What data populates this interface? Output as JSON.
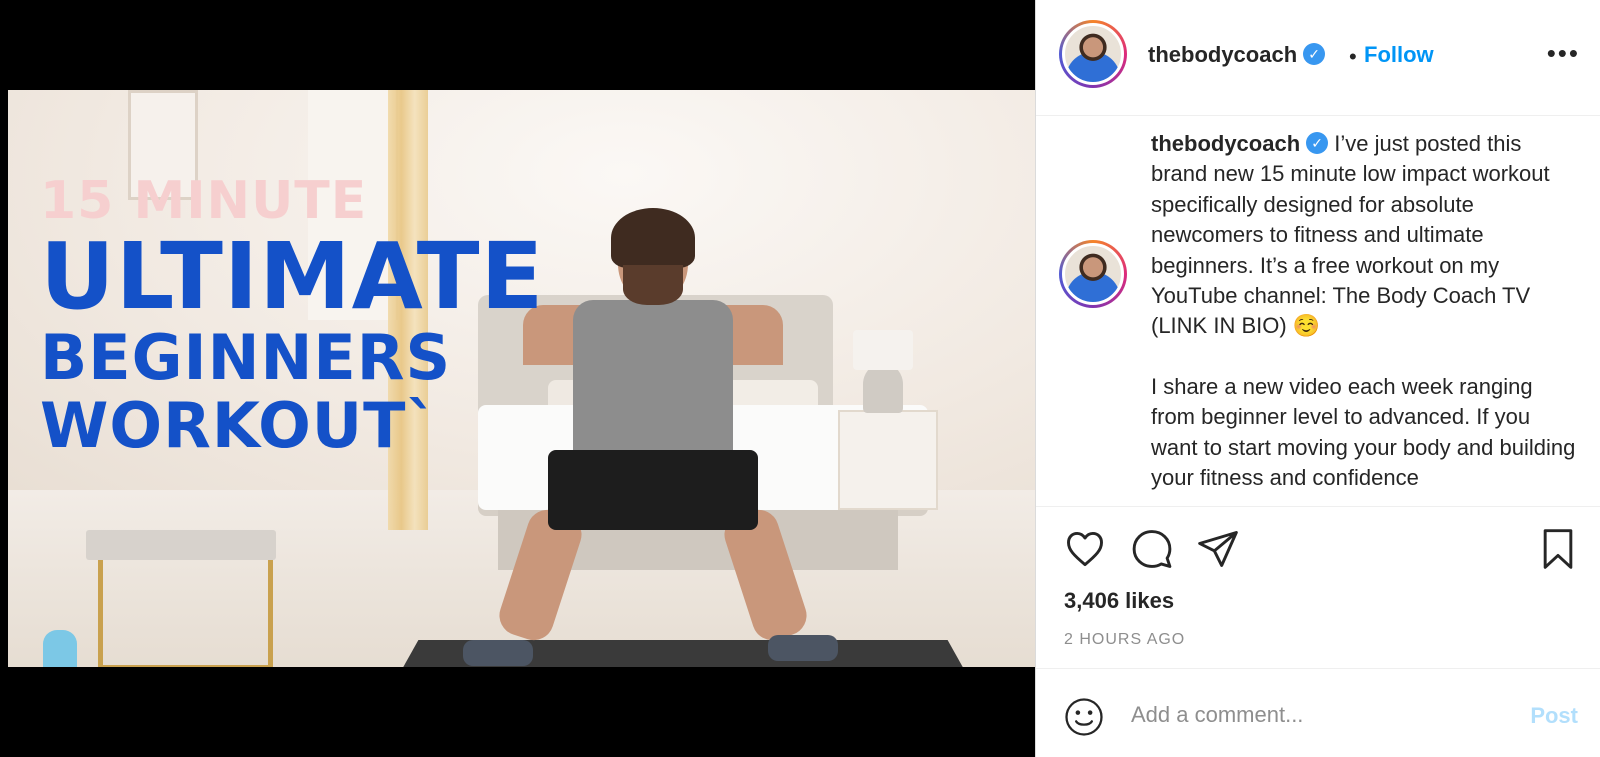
{
  "media": {
    "overlay": {
      "line1": "15 MINUTE",
      "line2": "ULTIMATE",
      "line3": "BEGINNERS",
      "line4": "WORKOUT`"
    }
  },
  "header": {
    "username": "thebodycoach",
    "separator": "•",
    "follow_label": "Follow",
    "more_label": "•••"
  },
  "caption": {
    "username": "thebodycoach",
    "paragraph1": "I’ve just posted this brand new 15 minute low impact workout specifically designed for absolute newcomers to fitness and ultimate beginners. It’s a free workout on my YouTube channel: The Body Coach TV (LINK IN BIO) ☺️",
    "paragraph2": "I share a new video each week ranging from beginner level to advanced. If you want to start moving your body and building your fitness and confidence"
  },
  "stats": {
    "likes": "3,406 likes",
    "time": "2 HOURS AGO"
  },
  "comment": {
    "placeholder": "Add a comment...",
    "post_label": "Post"
  },
  "colors": {
    "link_blue": "#0095f6",
    "verified_blue": "#3897f0",
    "post_disabled": "#b2dffc",
    "overlay_blue": "#1451c8",
    "overlay_pink": "#f6cfcf"
  },
  "icons": {
    "like": "heart-icon",
    "comment": "speech-bubble-icon",
    "share": "paper-plane-icon",
    "save": "bookmark-icon",
    "emoji": "smiley-icon",
    "verified": "verified-badge-icon"
  }
}
